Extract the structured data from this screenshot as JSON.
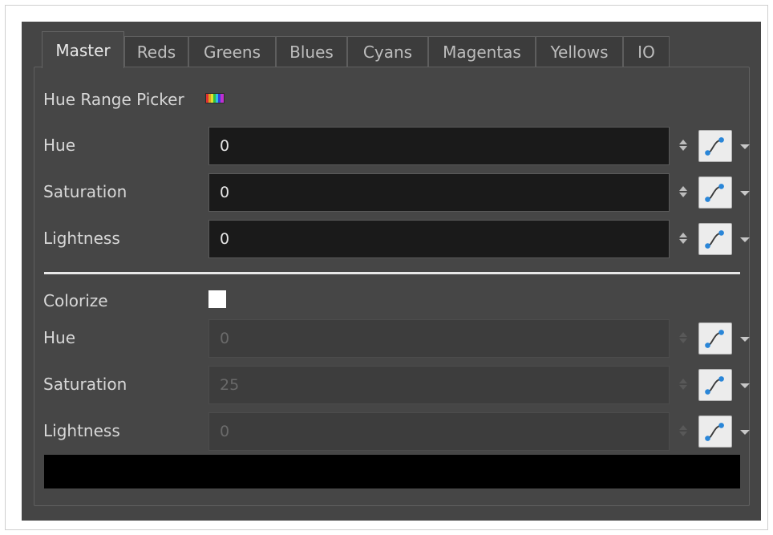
{
  "tabs": [
    {
      "label": "Master",
      "active": true
    },
    {
      "label": "Reds"
    },
    {
      "label": "Greens"
    },
    {
      "label": "Blues"
    },
    {
      "label": "Cyans"
    },
    {
      "label": "Magentas"
    },
    {
      "label": "Yellows"
    },
    {
      "label": "IO"
    }
  ],
  "hue_range_picker": {
    "label": "Hue Range Picker",
    "icon": "spectrum-icon"
  },
  "master": {
    "hue": {
      "label": "Hue",
      "value": "0"
    },
    "saturation": {
      "label": "Saturation",
      "value": "0"
    },
    "lightness": {
      "label": "Lightness",
      "value": "0"
    }
  },
  "colorize": {
    "label": "Colorize",
    "checked": false,
    "hue": {
      "label": "Hue",
      "value": "0"
    },
    "saturation": {
      "label": "Saturation",
      "value": "25"
    },
    "lightness": {
      "label": "Lightness",
      "value": "0"
    }
  },
  "icons": {
    "spinner": "up-down-spinner-icon",
    "curve": "function-curve-icon",
    "dropdown": "chevron-down-icon"
  },
  "colors": {
    "panel_bg": "#454545",
    "field_bg": "#1a1a1a",
    "curve_icon": "#2a86d8",
    "preview_swatch": "#000000"
  }
}
